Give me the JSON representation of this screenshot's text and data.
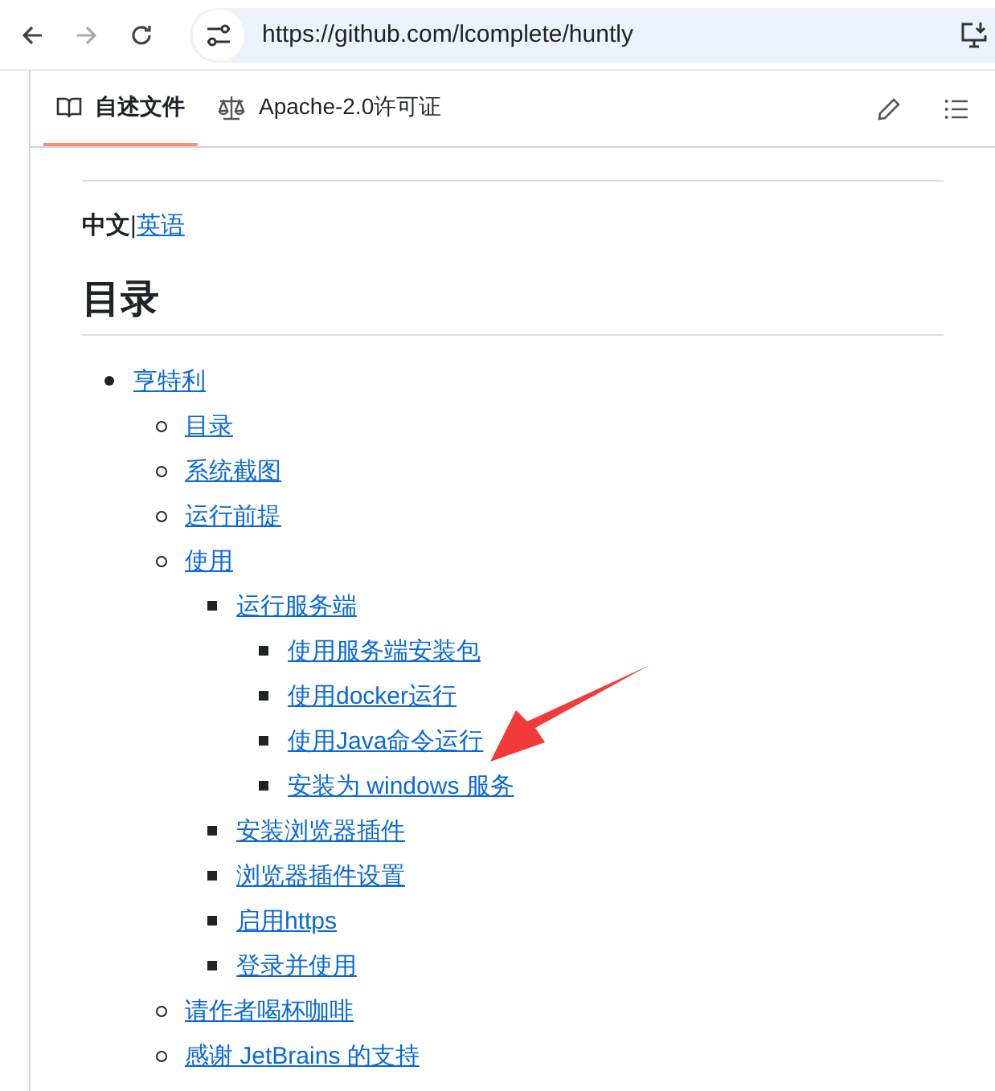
{
  "browser": {
    "url": "https://github.com/lcomplete/huntly",
    "back_disabled": false,
    "forward_disabled": true
  },
  "tabs": [
    {
      "label": "自述文件",
      "kind": "book",
      "selected": true
    },
    {
      "label": "Apache-2.0许可证",
      "kind": "scale",
      "selected": false
    }
  ],
  "language_switch": {
    "current": "中文",
    "separator": "|",
    "link": "英语"
  },
  "heading": "目录",
  "toc": [
    {
      "label": "亨特利",
      "children": [
        {
          "label": "目录"
        },
        {
          "label": "系统截图"
        },
        {
          "label": "运行前提"
        },
        {
          "label": "使用",
          "children": [
            {
              "label": "运行服务端",
              "children": [
                {
                  "label": "使用服务端安装包"
                },
                {
                  "label": "使用docker运行"
                },
                {
                  "label": "使用Java命令运行"
                },
                {
                  "label": "安装为 windows 服务"
                }
              ]
            },
            {
              "label": "安装浏览器插件"
            },
            {
              "label": "浏览器插件设置"
            },
            {
              "label": "启用https"
            },
            {
              "label": "登录并使用"
            }
          ]
        },
        {
          "label": "请作者喝杯咖啡"
        },
        {
          "label": "感谢 JetBrains 的支持"
        }
      ]
    }
  ]
}
